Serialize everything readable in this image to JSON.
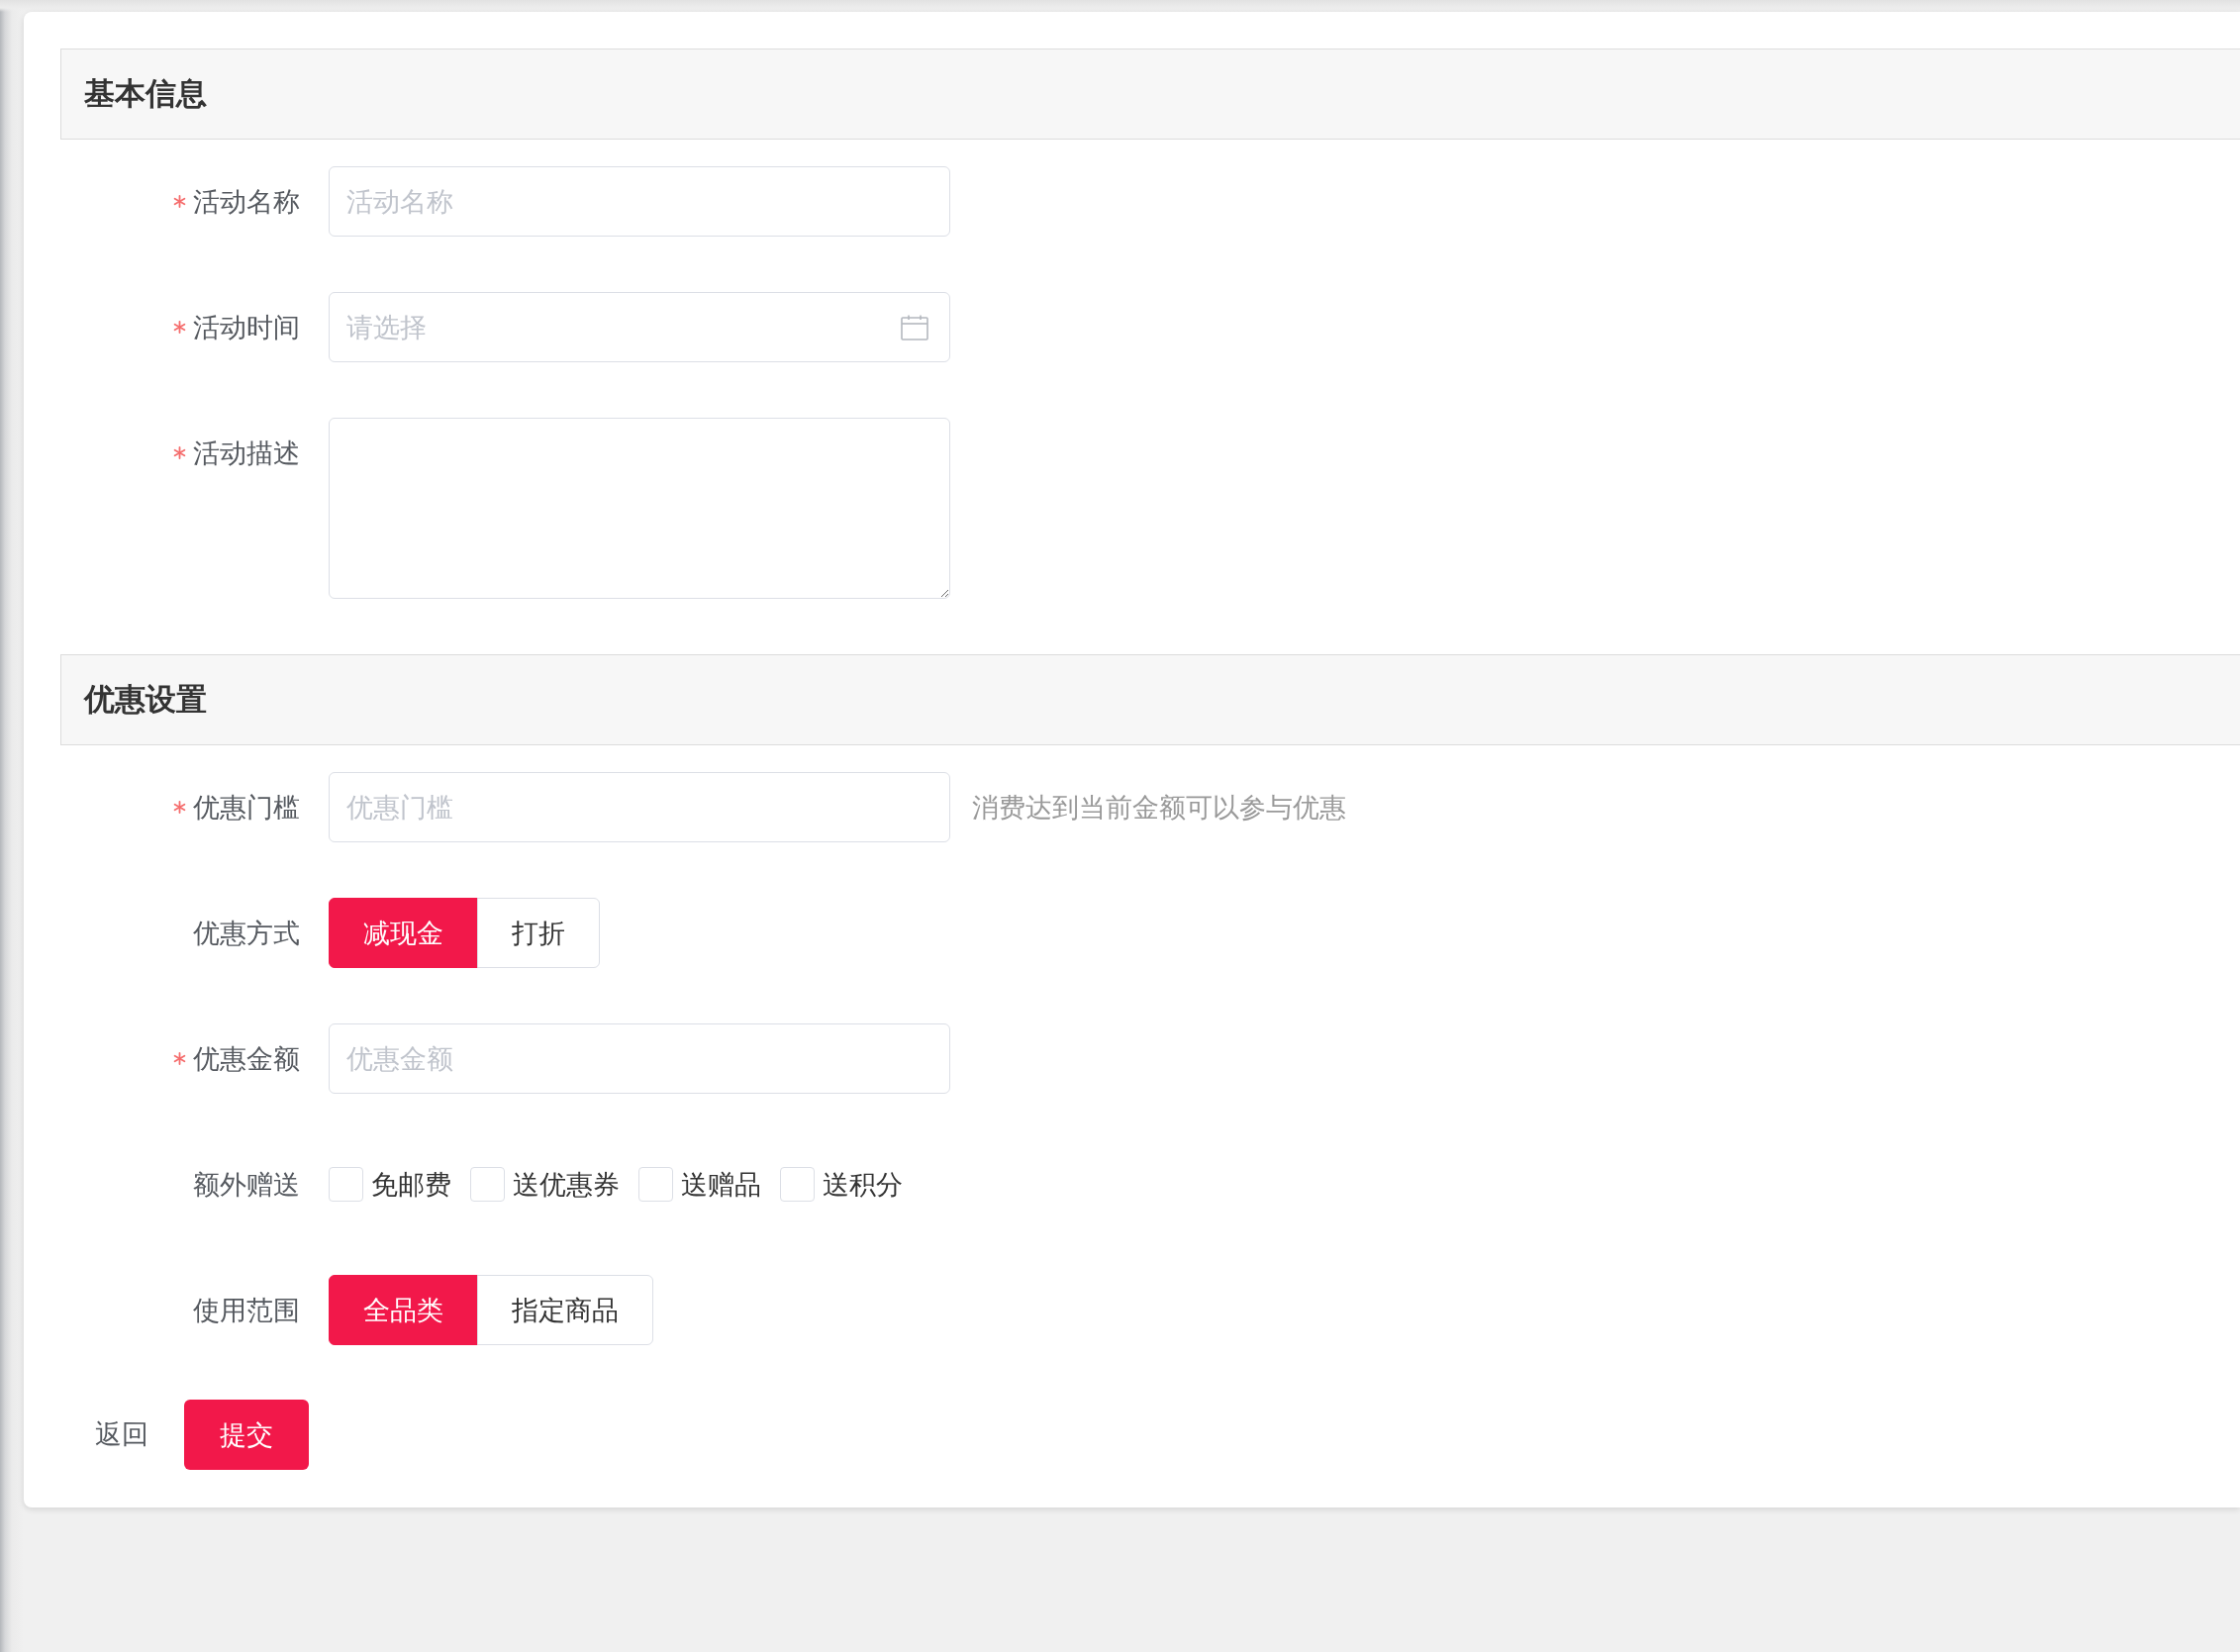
{
  "sections": [
    {
      "title": "基本信息",
      "fields": [
        {
          "kind": "text",
          "label": "活动名称",
          "required": true,
          "placeholder": "活动名称"
        },
        {
          "kind": "date",
          "label": "活动时间",
          "required": true,
          "placeholder": "请选择"
        },
        {
          "kind": "textarea",
          "label": "活动描述",
          "required": true
        }
      ]
    },
    {
      "title": "优惠设置",
      "fields": [
        {
          "kind": "text",
          "label": "优惠门槛",
          "required": true,
          "placeholder": "优惠门槛",
          "hint": "消费达到当前金额可以参与优惠"
        },
        {
          "kind": "segmented",
          "label": "优惠方式",
          "required": false,
          "options": [
            {
              "label": "减现金",
              "selected": true
            },
            {
              "label": "打折",
              "selected": false
            }
          ]
        },
        {
          "kind": "text",
          "label": "优惠金额",
          "required": true,
          "placeholder": "优惠金额"
        },
        {
          "kind": "checkboxes",
          "label": "额外赠送",
          "required": false,
          "options": [
            {
              "label": "免邮费",
              "checked": false
            },
            {
              "label": "送优惠券",
              "checked": false
            },
            {
              "label": "送赠品",
              "checked": false
            },
            {
              "label": "送积分",
              "checked": false
            }
          ]
        },
        {
          "kind": "segmented",
          "label": "使用范围",
          "required": false,
          "options": [
            {
              "label": "全品类",
              "selected": true
            },
            {
              "label": "指定商品",
              "selected": false
            }
          ]
        }
      ]
    }
  ],
  "footer": {
    "back": "返回",
    "submit": "提交"
  }
}
